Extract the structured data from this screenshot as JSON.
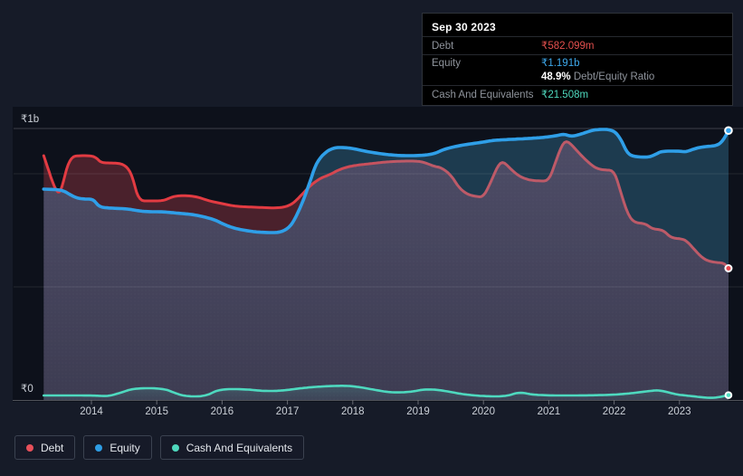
{
  "page": {
    "background": "#161b28",
    "plot_background": "#0d111b"
  },
  "tooltip": {
    "title": "Sep 30 2023",
    "debt_label": "Debt",
    "debt_value": "₹582.099m",
    "equity_label": "Equity",
    "equity_value": "₹1.191b",
    "ratio_value": "48.9%",
    "ratio_label": "Debt/Equity Ratio",
    "cash_label": "Cash And Equivalents",
    "cash_value": "₹21.508m",
    "debt_color": "#e4504e",
    "equity_color": "#3ea9ec",
    "cash_color": "#4fd8bd"
  },
  "legend": {
    "items": [
      {
        "label": "Debt",
        "color": "#e8505a"
      },
      {
        "label": "Equity",
        "color": "#2e9de4"
      },
      {
        "label": "Cash And Equivalents",
        "color": "#4fd8bd"
      }
    ]
  },
  "chart_data": {
    "type": "area",
    "unit": "₹ millions",
    "x_range": [
      2013.27,
      2023.75
    ],
    "x_axis": {
      "tick_labels": [
        "2014",
        "2015",
        "2016",
        "2017",
        "2018",
        "2019",
        "2020",
        "2021",
        "2022",
        "2023"
      ]
    },
    "y_axis": {
      "top_label": "₹1b",
      "bottom_label": "₹0",
      "gridlines_m": [
        {
          "value": 1200,
          "strong": true
        },
        {
          "value": 1000,
          "strong": false
        },
        {
          "value": 500,
          "strong": false
        }
      ]
    },
    "region_colors": {
      "both_below": [
        "#4d4c66",
        "#3d3c52"
      ],
      "equity_over_debt": "#1d3b4f",
      "debt_over_equity": "#4a212c",
      "cash_glow": "#4ed9bf"
    },
    "series": [
      {
        "name": "Debt",
        "color_start": "#e33b42",
        "color_end": "#bd5a68",
        "width": 3,
        "points": [
          [
            2013.27,
            1080
          ],
          [
            2013.34,
            1020
          ],
          [
            2013.42,
            950
          ],
          [
            2013.5,
            908
          ],
          [
            2013.56,
            950
          ],
          [
            2013.63,
            1036
          ],
          [
            2013.71,
            1076
          ],
          [
            2013.8,
            1080
          ],
          [
            2014.0,
            1080
          ],
          [
            2014.08,
            1070
          ],
          [
            2014.15,
            1048
          ],
          [
            2014.3,
            1048
          ],
          [
            2014.5,
            1044
          ],
          [
            2014.62,
            1000
          ],
          [
            2014.72,
            880
          ],
          [
            2014.9,
            880
          ],
          [
            2015.1,
            880
          ],
          [
            2015.25,
            900
          ],
          [
            2015.4,
            904
          ],
          [
            2015.6,
            900
          ],
          [
            2015.8,
            880
          ],
          [
            2016.0,
            868
          ],
          [
            2016.2,
            856
          ],
          [
            2016.5,
            852
          ],
          [
            2016.85,
            848
          ],
          [
            2017.0,
            856
          ],
          [
            2017.1,
            872
          ],
          [
            2017.22,
            908
          ],
          [
            2017.35,
            948
          ],
          [
            2017.5,
            980
          ],
          [
            2017.65,
            996
          ],
          [
            2017.8,
            1020
          ],
          [
            2018.0,
            1036
          ],
          [
            2018.25,
            1044
          ],
          [
            2018.5,
            1052
          ],
          [
            2018.75,
            1056
          ],
          [
            2019.0,
            1056
          ],
          [
            2019.12,
            1048
          ],
          [
            2019.25,
            1032
          ],
          [
            2019.35,
            1028
          ],
          [
            2019.5,
            996
          ],
          [
            2019.63,
            936
          ],
          [
            2019.76,
            908
          ],
          [
            2019.88,
            900
          ],
          [
            2020.0,
            896
          ],
          [
            2020.12,
            968
          ],
          [
            2020.22,
            1036
          ],
          [
            2020.3,
            1056
          ],
          [
            2020.42,
            1020
          ],
          [
            2020.55,
            988
          ],
          [
            2020.7,
            972
          ],
          [
            2020.85,
            968
          ],
          [
            2021.0,
            968
          ],
          [
            2021.1,
            1048
          ],
          [
            2021.2,
            1128
          ],
          [
            2021.28,
            1148
          ],
          [
            2021.4,
            1112
          ],
          [
            2021.5,
            1080
          ],
          [
            2021.6,
            1052
          ],
          [
            2021.72,
            1024
          ],
          [
            2021.85,
            1016
          ],
          [
            2022.0,
            1016
          ],
          [
            2022.1,
            920
          ],
          [
            2022.2,
            828
          ],
          [
            2022.3,
            784
          ],
          [
            2022.48,
            780
          ],
          [
            2022.58,
            756
          ],
          [
            2022.75,
            752
          ],
          [
            2022.87,
            716
          ],
          [
            2023.05,
            712
          ],
          [
            2023.12,
            700
          ],
          [
            2023.22,
            668
          ],
          [
            2023.32,
            636
          ],
          [
            2023.42,
            616
          ],
          [
            2023.55,
            608
          ],
          [
            2023.68,
            606
          ],
          [
            2023.75,
            582
          ]
        ]
      },
      {
        "name": "Equity",
        "color": "#2f9fe8",
        "width": 3.6,
        "points": [
          [
            2013.27,
            932
          ],
          [
            2013.5,
            930
          ],
          [
            2013.6,
            921
          ],
          [
            2013.67,
            908
          ],
          [
            2013.78,
            892
          ],
          [
            2013.9,
            888
          ],
          [
            2014.03,
            888
          ],
          [
            2014.12,
            852
          ],
          [
            2014.3,
            848
          ],
          [
            2014.55,
            845
          ],
          [
            2014.7,
            837
          ],
          [
            2014.85,
            832
          ],
          [
            2015.1,
            832
          ],
          [
            2015.35,
            825
          ],
          [
            2015.55,
            820
          ],
          [
            2015.75,
            808
          ],
          [
            2015.9,
            795
          ],
          [
            2016.0,
            780
          ],
          [
            2016.15,
            762
          ],
          [
            2016.35,
            749
          ],
          [
            2016.6,
            740
          ],
          [
            2017.0,
            740
          ],
          [
            2017.2,
            848
          ],
          [
            2017.35,
            968
          ],
          [
            2017.44,
            1048
          ],
          [
            2017.58,
            1096
          ],
          [
            2017.72,
            1116
          ],
          [
            2017.86,
            1116
          ],
          [
            2018.0,
            1112
          ],
          [
            2018.24,
            1096
          ],
          [
            2018.65,
            1080
          ],
          [
            2019.04,
            1080
          ],
          [
            2019.25,
            1088
          ],
          [
            2019.39,
            1108
          ],
          [
            2019.62,
            1124
          ],
          [
            2019.8,
            1132
          ],
          [
            2020.0,
            1140
          ],
          [
            2020.15,
            1148
          ],
          [
            2020.42,
            1152
          ],
          [
            2020.7,
            1156
          ],
          [
            2020.9,
            1160
          ],
          [
            2021.12,
            1168
          ],
          [
            2021.23,
            1176
          ],
          [
            2021.35,
            1164
          ],
          [
            2021.5,
            1176
          ],
          [
            2021.62,
            1188
          ],
          [
            2021.73,
            1196
          ],
          [
            2021.98,
            1196
          ],
          [
            2022.1,
            1156
          ],
          [
            2022.19,
            1096
          ],
          [
            2022.28,
            1076
          ],
          [
            2022.53,
            1072
          ],
          [
            2022.65,
            1088
          ],
          [
            2022.73,
            1100
          ],
          [
            2023.0,
            1100
          ],
          [
            2023.1,
            1096
          ],
          [
            2023.24,
            1112
          ],
          [
            2023.38,
            1120
          ],
          [
            2023.58,
            1124
          ],
          [
            2023.67,
            1148
          ],
          [
            2023.75,
            1191
          ]
        ]
      },
      {
        "name": "Cash And Equivalents",
        "color": "#4ed9bf",
        "width": 2.6,
        "points": [
          [
            2013.27,
            20
          ],
          [
            2014.05,
            20
          ],
          [
            2014.25,
            16
          ],
          [
            2014.45,
            32
          ],
          [
            2014.65,
            52
          ],
          [
            2015.1,
            52
          ],
          [
            2015.3,
            28
          ],
          [
            2015.45,
            16
          ],
          [
            2015.75,
            16
          ],
          [
            2015.95,
            48
          ],
          [
            2016.35,
            48
          ],
          [
            2016.6,
            40
          ],
          [
            2016.9,
            40
          ],
          [
            2017.3,
            56
          ],
          [
            2017.8,
            64
          ],
          [
            2018.05,
            60
          ],
          [
            2018.35,
            44
          ],
          [
            2018.6,
            32
          ],
          [
            2018.9,
            36
          ],
          [
            2019.1,
            48
          ],
          [
            2019.35,
            44
          ],
          [
            2019.7,
            24
          ],
          [
            2020.05,
            16
          ],
          [
            2020.35,
            16
          ],
          [
            2020.55,
            36
          ],
          [
            2020.8,
            20
          ],
          [
            2021.6,
            20
          ],
          [
            2022.1,
            24
          ],
          [
            2022.55,
            40
          ],
          [
            2022.7,
            44
          ],
          [
            2022.95,
            24
          ],
          [
            2023.1,
            20
          ],
          [
            2023.45,
            8
          ],
          [
            2023.6,
            12
          ],
          [
            2023.75,
            21.5
          ]
        ]
      }
    ],
    "end_values_m": {
      "Debt": 582.099,
      "Equity": 1191,
      "Cash And Equivalents": 21.508
    }
  }
}
